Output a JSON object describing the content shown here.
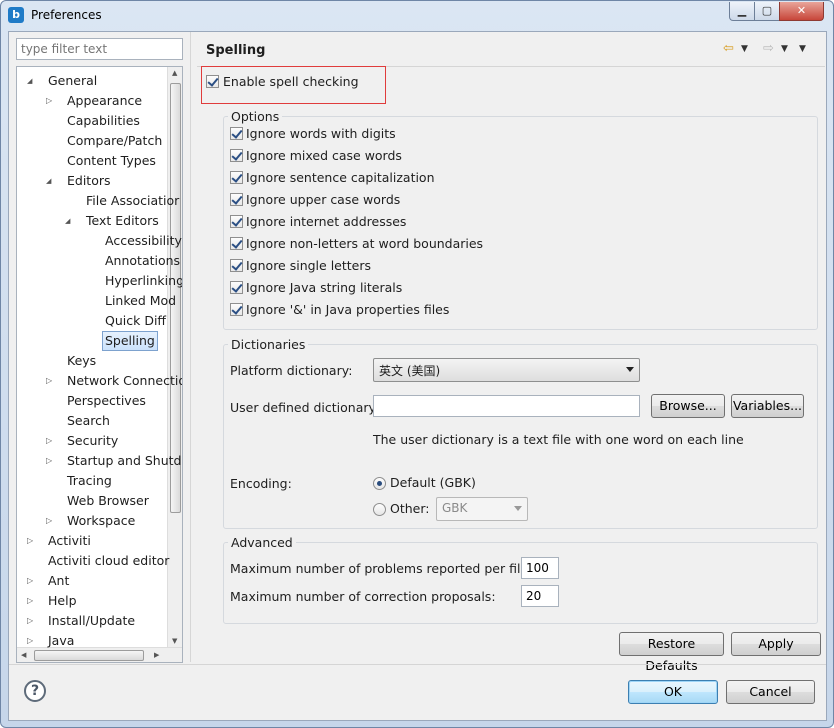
{
  "window": {
    "title": "Preferences"
  },
  "filter": {
    "placeholder": "type filter text"
  },
  "tree": [
    {
      "label": "General",
      "level": 0,
      "twisty": "open"
    },
    {
      "label": "Appearance",
      "level": 1,
      "twisty": "closed"
    },
    {
      "label": "Capabilities",
      "level": 1,
      "twisty": "none"
    },
    {
      "label": "Compare/Patch",
      "level": 1,
      "twisty": "none"
    },
    {
      "label": "Content Types",
      "level": 1,
      "twisty": "none"
    },
    {
      "label": "Editors",
      "level": 1,
      "twisty": "open"
    },
    {
      "label": "File Associatior",
      "level": 2,
      "twisty": "none"
    },
    {
      "label": "Text Editors",
      "level": 2,
      "twisty": "open"
    },
    {
      "label": "Accessibility",
      "level": 3,
      "twisty": "none"
    },
    {
      "label": "Annotations",
      "level": 3,
      "twisty": "none"
    },
    {
      "label": "Hyperlinking",
      "level": 3,
      "twisty": "none"
    },
    {
      "label": "Linked Mod",
      "level": 3,
      "twisty": "none"
    },
    {
      "label": "Quick Diff",
      "level": 3,
      "twisty": "none"
    },
    {
      "label": "Spelling",
      "level": 3,
      "twisty": "none",
      "selected": true
    },
    {
      "label": "Keys",
      "level": 1,
      "twisty": "none"
    },
    {
      "label": "Network Connectio",
      "level": 1,
      "twisty": "closed"
    },
    {
      "label": "Perspectives",
      "level": 1,
      "twisty": "none"
    },
    {
      "label": "Search",
      "level": 1,
      "twisty": "none"
    },
    {
      "label": "Security",
      "level": 1,
      "twisty": "closed"
    },
    {
      "label": "Startup and Shutd",
      "level": 1,
      "twisty": "closed"
    },
    {
      "label": "Tracing",
      "level": 1,
      "twisty": "none"
    },
    {
      "label": "Web Browser",
      "level": 1,
      "twisty": "none"
    },
    {
      "label": "Workspace",
      "level": 1,
      "twisty": "closed"
    },
    {
      "label": "Activiti",
      "level": 0,
      "twisty": "closed"
    },
    {
      "label": "Activiti cloud editor",
      "level": 0,
      "twisty": "none"
    },
    {
      "label": "Ant",
      "level": 0,
      "twisty": "closed"
    },
    {
      "label": "Help",
      "level": 0,
      "twisty": "closed"
    },
    {
      "label": "Install/Update",
      "level": 0,
      "twisty": "closed"
    },
    {
      "label": "Java",
      "level": 0,
      "twisty": "closed"
    }
  ],
  "page": {
    "title": "Spelling",
    "enable_label": "Enable spell checking",
    "enable_checked": true
  },
  "options": {
    "title": "Options",
    "items": [
      {
        "label": "Ignore words with digits",
        "checked": true
      },
      {
        "label": "Ignore mixed case words",
        "checked": true
      },
      {
        "label": "Ignore sentence capitalization",
        "checked": true
      },
      {
        "label": "Ignore upper case words",
        "checked": true
      },
      {
        "label": "Ignore internet addresses",
        "checked": true
      },
      {
        "label": "Ignore non-letters at word boundaries",
        "checked": true
      },
      {
        "label": "Ignore single letters",
        "checked": true
      },
      {
        "label": "Ignore Java string literals",
        "checked": true
      },
      {
        "label": "Ignore '&' in Java properties files",
        "checked": true
      }
    ]
  },
  "dictionaries": {
    "title": "Dictionaries",
    "platform_label": "Platform dictionary:",
    "platform_value": "英文 (美国)",
    "user_label": "User defined dictionary:",
    "user_value": "",
    "browse_label": "Browse...",
    "variables_label": "Variables...",
    "hint": "The user dictionary is a text file with one word on each line",
    "encoding_label": "Encoding:",
    "default_label": "Default (GBK)",
    "other_label": "Other:",
    "other_value": "GBK"
  },
  "advanced": {
    "title": "Advanced",
    "max_problems_label": "Maximum number of problems reported per file:",
    "max_problems_value": "100",
    "max_proposals_label": "Maximum number of correction proposals:",
    "max_proposals_value": "20"
  },
  "buttons": {
    "restore": "Restore Defaults",
    "apply": "Apply",
    "ok": "OK",
    "cancel": "Cancel"
  }
}
